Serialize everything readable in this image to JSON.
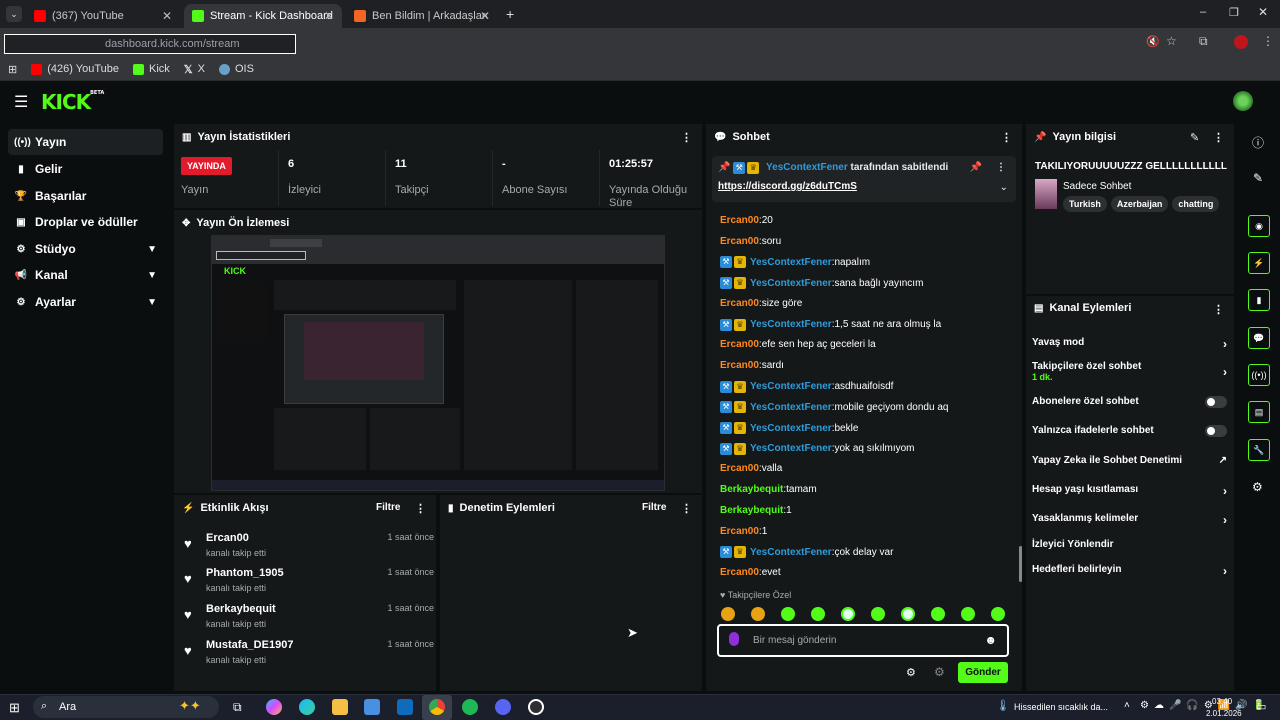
{
  "browser": {
    "tabs": [
      {
        "title": "(367) YouTube",
        "color": "#ff0000"
      },
      {
        "title": "Stream - Kick Dashboard",
        "color": "#53fc18"
      },
      {
        "title": "Ben Bildim | Arkadaşlarınla Onl",
        "color": "#f26522"
      }
    ],
    "url": "dashboard.kick.com/stream",
    "bookmarks": [
      "(426) YouTube",
      "Kick",
      "X",
      "OIS"
    ]
  },
  "header": {
    "logo": "KICK",
    "logo_sup": "BETA"
  },
  "sidebar": {
    "items": [
      {
        "label": "Yayın",
        "icon": "((•))"
      },
      {
        "label": "Gelir",
        "icon": "▮"
      },
      {
        "label": "Başarılar",
        "icon": "🏆"
      },
      {
        "label": "Droplar ve ödüller",
        "icon": "▣"
      },
      {
        "label": "Stüdyo",
        "icon": "⚙"
      },
      {
        "label": "Kanal",
        "icon": "📢"
      },
      {
        "label": "Ayarlar",
        "icon": "⚙"
      }
    ]
  },
  "stats": {
    "title": "Yayın İstatistikleri",
    "live_badge": "YAYINDA",
    "items": [
      {
        "value": "",
        "label": "Yayın"
      },
      {
        "value": "6",
        "label": "İzleyici"
      },
      {
        "value": "11",
        "label": "Takipçi"
      },
      {
        "value": "-",
        "label": "Abone Sayısı"
      },
      {
        "value": "01:25:57",
        "label": "Yayında Olduğu Süre"
      }
    ]
  },
  "preview": {
    "title": "Yayın Ön İzlemesi"
  },
  "activity": {
    "title": "Etkinlik Akışı",
    "filter": "Filtre",
    "events": [
      {
        "name": "Ercan00",
        "action": "kanalı takip etti",
        "time": "1 saat önce"
      },
      {
        "name": "Phantom_1905",
        "action": "kanalı takip etti",
        "time": "1 saat önce"
      },
      {
        "name": "Berkaybequit",
        "action": "kanalı takip etti",
        "time": "1 saat önce"
      },
      {
        "name": "Mustafa_DE1907",
        "action": "kanalı takip etti",
        "time": "1 saat önce"
      }
    ]
  },
  "moderation": {
    "title": "Denetim Eylemleri",
    "filter": "Filtre"
  },
  "chat": {
    "title": "Sohbet",
    "pinned_by": "YesContextFener",
    "pinned_suffix": "tarafından sabitlendi",
    "pinned_link": "https://discord.gg/z6duTCmS",
    "messages": [
      {
        "user": "Ercan00",
        "text": "20",
        "badges": false,
        "color": "#ff8a1e"
      },
      {
        "user": "Ercan00",
        "text": "soru",
        "badges": false,
        "color": "#ff8a1e"
      },
      {
        "user": "YesContextFener",
        "text": "napalım",
        "badges": true,
        "color": "#2d9cdb"
      },
      {
        "user": "YesContextFener",
        "text": "sana bağlı yayıncım",
        "badges": true,
        "color": "#2d9cdb"
      },
      {
        "user": "Ercan00",
        "text": "size göre",
        "badges": false,
        "color": "#ff8a1e"
      },
      {
        "user": "YesContextFener",
        "text": "1,5 saat ne ara olmuş la",
        "badges": true,
        "color": "#2d9cdb"
      },
      {
        "user": "Ercan00",
        "text": "efe sen hep aç geceleri la",
        "badges": false,
        "color": "#ff8a1e"
      },
      {
        "user": "Ercan00",
        "text": "sardı",
        "badges": false,
        "color": "#ff8a1e"
      },
      {
        "user": "YesContextFener",
        "text": "asdhuaifoisdf",
        "badges": true,
        "color": "#2d9cdb"
      },
      {
        "user": "YesContextFener",
        "text": "mobile geçiyom dondu aq",
        "badges": true,
        "color": "#2d9cdb"
      },
      {
        "user": "YesContextFener",
        "text": "bekle",
        "badges": true,
        "color": "#2d9cdb"
      },
      {
        "user": "YesContextFener",
        "text": "yok aq sıkılmıyom",
        "badges": true,
        "color": "#2d9cdb"
      },
      {
        "user": "Ercan00",
        "text": "valla",
        "badges": false,
        "color": "#ff8a1e"
      },
      {
        "user": "Berkaybequit",
        "text": "tamam",
        "badges": false,
        "color": "#53fc18"
      },
      {
        "user": "Berkaybequit",
        "text": "1",
        "badges": false,
        "color": "#53fc18"
      },
      {
        "user": "Ercan00",
        "text": "1",
        "badges": false,
        "color": "#ff8a1e"
      },
      {
        "user": "YesContextFener",
        "text": "çok delay var",
        "badges": true,
        "color": "#2d9cdb"
      },
      {
        "user": "Ercan00",
        "text": "evet",
        "badges": false,
        "color": "#ff8a1e"
      }
    ],
    "emote_header": "Takipçilere Özel",
    "input_placeholder": "Bir mesaj gönderin",
    "send": "Gönder"
  },
  "stream_info": {
    "title": "Yayın bilgisi",
    "stream_title": "TAKILIYORUUUUUZZZ GELLLLLLLLLLL",
    "category": "Sadece Sohbet",
    "tags": [
      "Turkish",
      "Azerbaijan",
      "chatting"
    ]
  },
  "channel_actions": {
    "title": "Kanal Eylemleri",
    "items": [
      {
        "label": "Yavaş mod",
        "kind": "arrow"
      },
      {
        "label": "Takipçilere özel sohbet",
        "sub": "1 dk.",
        "kind": "arrow"
      },
      {
        "label": "Abonelere özel sohbet",
        "kind": "toggle"
      },
      {
        "label": "Yalnızca ifadelerle sohbet",
        "kind": "toggle"
      },
      {
        "label": "Yapay Zeka ile Sohbet Denetimi",
        "kind": "external"
      },
      {
        "label": "Hesap yaşı kısıtlaması",
        "kind": "arrow"
      },
      {
        "label": "Yasaklanmış kelimeler",
        "kind": "arrow"
      },
      {
        "label": "İzleyici Yönlendir",
        "kind": "none"
      },
      {
        "label": "Hedefleri belirleyin",
        "kind": "arrow"
      }
    ]
  },
  "taskbar": {
    "search": "Ara",
    "weather": "Hissedilen sıcaklık da...",
    "time": "03:40",
    "date": "2.01.2026"
  }
}
